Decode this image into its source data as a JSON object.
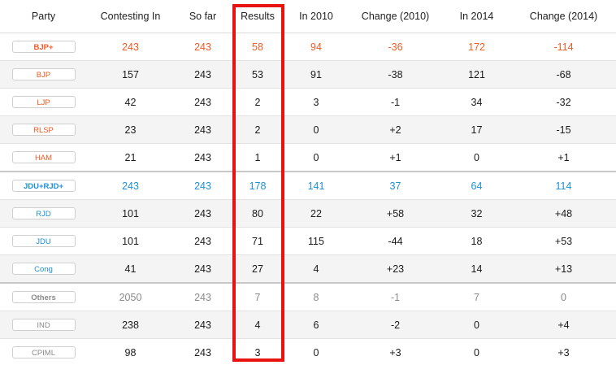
{
  "columns": [
    "Party",
    "Contesting In",
    "So far",
    "Results",
    "In 2010",
    "Change (2010)",
    "In 2014",
    "Change (2014)"
  ],
  "groups": [
    {
      "color": "#f05a24",
      "row": {
        "party": "BJP+",
        "contesting": "243",
        "so_far": "243",
        "results": "58",
        "in_2010": "94",
        "change_2010": "-36",
        "in_2014": "172",
        "change_2014": "-114"
      },
      "members": [
        {
          "party": "BJP",
          "contesting": "157",
          "so_far": "243",
          "results": "53",
          "in_2010": "91",
          "change_2010": "-38",
          "in_2014": "121",
          "change_2014": "-68"
        },
        {
          "party": "LJP",
          "contesting": "42",
          "so_far": "243",
          "results": "2",
          "in_2010": "3",
          "change_2010": "-1",
          "in_2014": "34",
          "change_2014": "-32"
        },
        {
          "party": "RLSP",
          "contesting": "23",
          "so_far": "243",
          "results": "2",
          "in_2010": "0",
          "change_2010": "+2",
          "in_2014": "17",
          "change_2014": "-15"
        },
        {
          "party": "HAM",
          "contesting": "21",
          "so_far": "243",
          "results": "1",
          "in_2010": "0",
          "change_2010": "+1",
          "in_2014": "0",
          "change_2014": "+1"
        }
      ]
    },
    {
      "color": "#1e8fd6",
      "row": {
        "party": "JDU+RJD+",
        "contesting": "243",
        "so_far": "243",
        "results": "178",
        "in_2010": "141",
        "change_2010": "37",
        "in_2014": "64",
        "change_2014": "114"
      },
      "members": [
        {
          "party": "RJD",
          "contesting": "101",
          "so_far": "243",
          "results": "80",
          "in_2010": "22",
          "change_2010": "+58",
          "in_2014": "32",
          "change_2014": "+48"
        },
        {
          "party": "JDU",
          "contesting": "101",
          "so_far": "243",
          "results": "71",
          "in_2010": "115",
          "change_2010": "-44",
          "in_2014": "18",
          "change_2014": "+53"
        },
        {
          "party": "Cong",
          "contesting": "41",
          "so_far": "243",
          "results": "27",
          "in_2010": "4",
          "change_2010": "+23",
          "in_2014": "14",
          "change_2014": "+13"
        }
      ]
    },
    {
      "color": "#8a8a8a",
      "row": {
        "party": "Others",
        "contesting": "2050",
        "so_far": "243",
        "results": "7",
        "in_2010": "8",
        "change_2010": "-1",
        "in_2014": "7",
        "change_2014": "0"
      },
      "members": [
        {
          "party": "IND",
          "contesting": "238",
          "so_far": "243",
          "results": "4",
          "in_2010": "6",
          "change_2010": "-2",
          "in_2014": "0",
          "change_2014": "+4"
        },
        {
          "party": "CPIML",
          "contesting": "98",
          "so_far": "243",
          "results": "3",
          "in_2010": "0",
          "change_2010": "+3",
          "in_2014": "0",
          "change_2014": "+3"
        }
      ]
    }
  ],
  "highlight_color": "#e8120f"
}
